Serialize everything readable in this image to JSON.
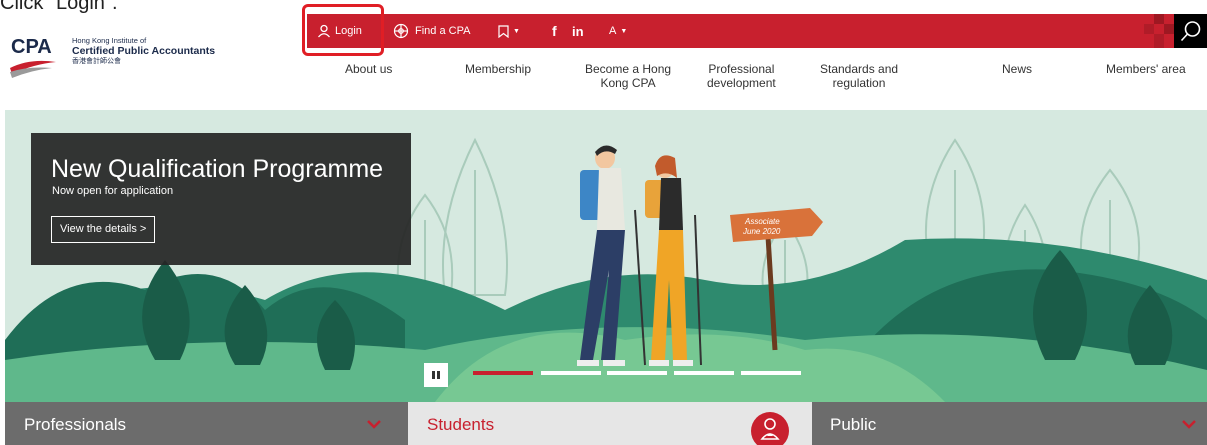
{
  "instruction": "Click \"Login\".",
  "logo": {
    "abbr": "CPA",
    "line1": "Hong Kong Institute of",
    "line2": "Certified Public Accountants",
    "line3": "香港會計師公會"
  },
  "topbar": {
    "login_label": "Login",
    "findcpa_label": "Find a CPA",
    "facebook_label": "f",
    "linkedin_label": "in",
    "fontsize_label": "A"
  },
  "nav": [
    {
      "line1": "About us",
      "line2": ""
    },
    {
      "line1": "Membership",
      "line2": ""
    },
    {
      "line1": "Become a Hong",
      "line2": "Kong CPA"
    },
    {
      "line1": "Professional",
      "line2": "development"
    },
    {
      "line1": "Standards and",
      "line2": "regulation"
    },
    {
      "line1": "News",
      "line2": ""
    },
    {
      "line1": "Members' area",
      "line2": ""
    }
  ],
  "promo": {
    "title": "New Qualification Programme",
    "subtitle": "Now open for application",
    "cta_label": "View the details >"
  },
  "signpost": {
    "line1": "Associate",
    "line2": "June 2020"
  },
  "panels": {
    "professionals": "Professionals",
    "students": "Students",
    "public": "Public"
  },
  "colors": {
    "brand_red": "#c8202e",
    "hero_bg": "#d6e9e0",
    "panel_grey": "#6c6c6c",
    "panel_light": "#e6e6e6"
  }
}
